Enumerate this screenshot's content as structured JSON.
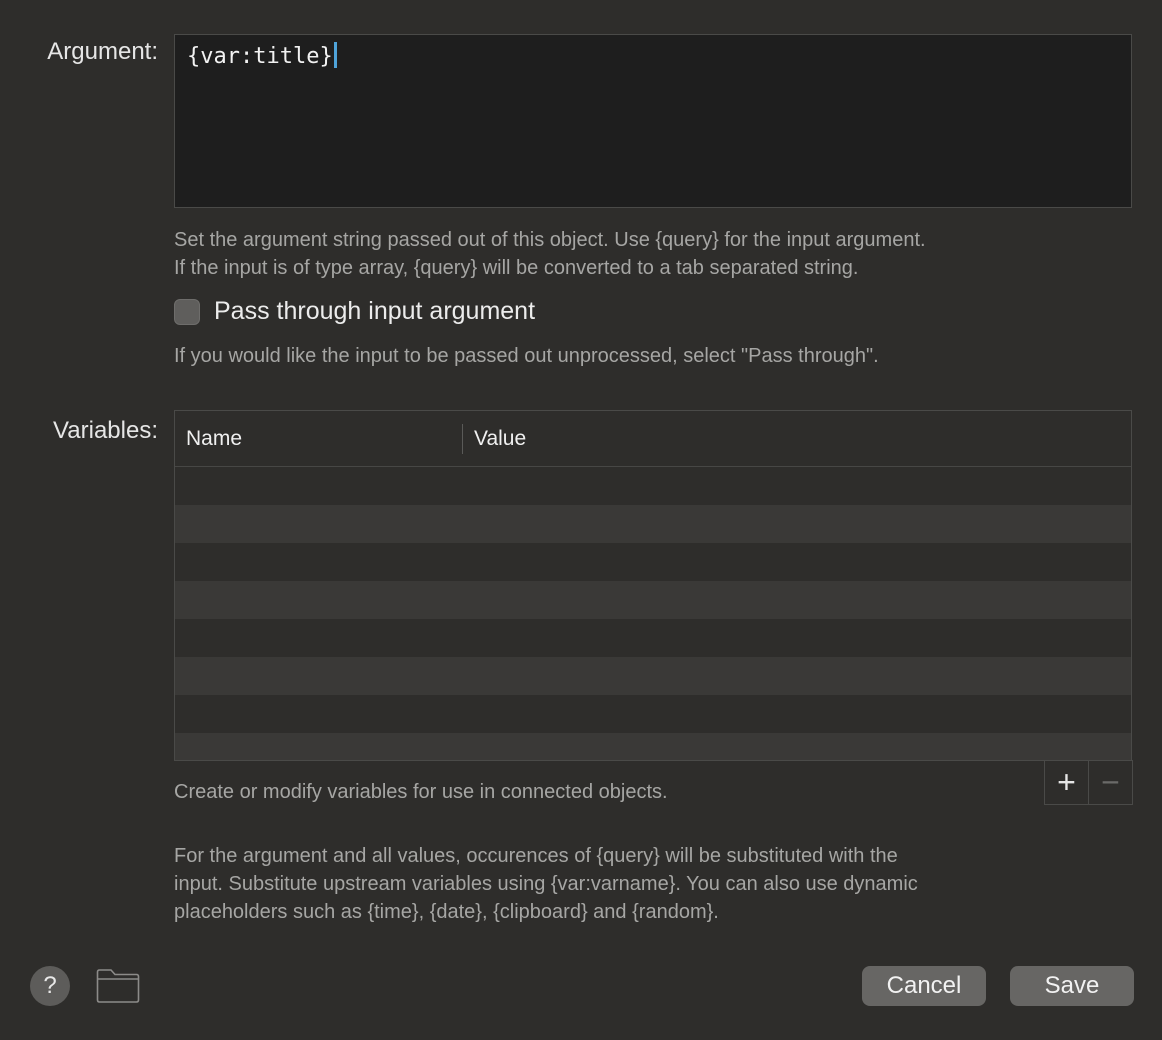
{
  "argument": {
    "label": "Argument:",
    "value": "{var:title}",
    "help_line1": "Set the argument string passed out of this object. Use {query} for the input argument.",
    "help_line2": "If the input is of type array, {query} will be converted to a tab separated string."
  },
  "pass_through": {
    "label": "Pass through input argument",
    "checked": false,
    "help": "If you would like the input to be passed out unprocessed, select \"Pass through\"."
  },
  "variables": {
    "label": "Variables:",
    "columns": [
      "Name",
      "Value"
    ],
    "rows": [],
    "help": "Create or modify variables for use in connected objects.",
    "add_label": "+",
    "remove_label": "−"
  },
  "footer_note": {
    "line1": "For the argument and all values, occurences of {query} will be substituted with the",
    "line2": "input. Substitute upstream variables using {var:varname}. You can also use dynamic",
    "line3": "placeholders such as {time}, {date}, {clipboard} and {random}."
  },
  "buttons": {
    "help": "?",
    "cancel": "Cancel",
    "save": "Save"
  },
  "icons": {
    "help": "question-mark-icon",
    "folder": "folder-icon"
  },
  "colors": {
    "background": "#2e2d2b",
    "field": "#1e1e1e",
    "caret": "#4fa3d9",
    "button": "#676664"
  }
}
